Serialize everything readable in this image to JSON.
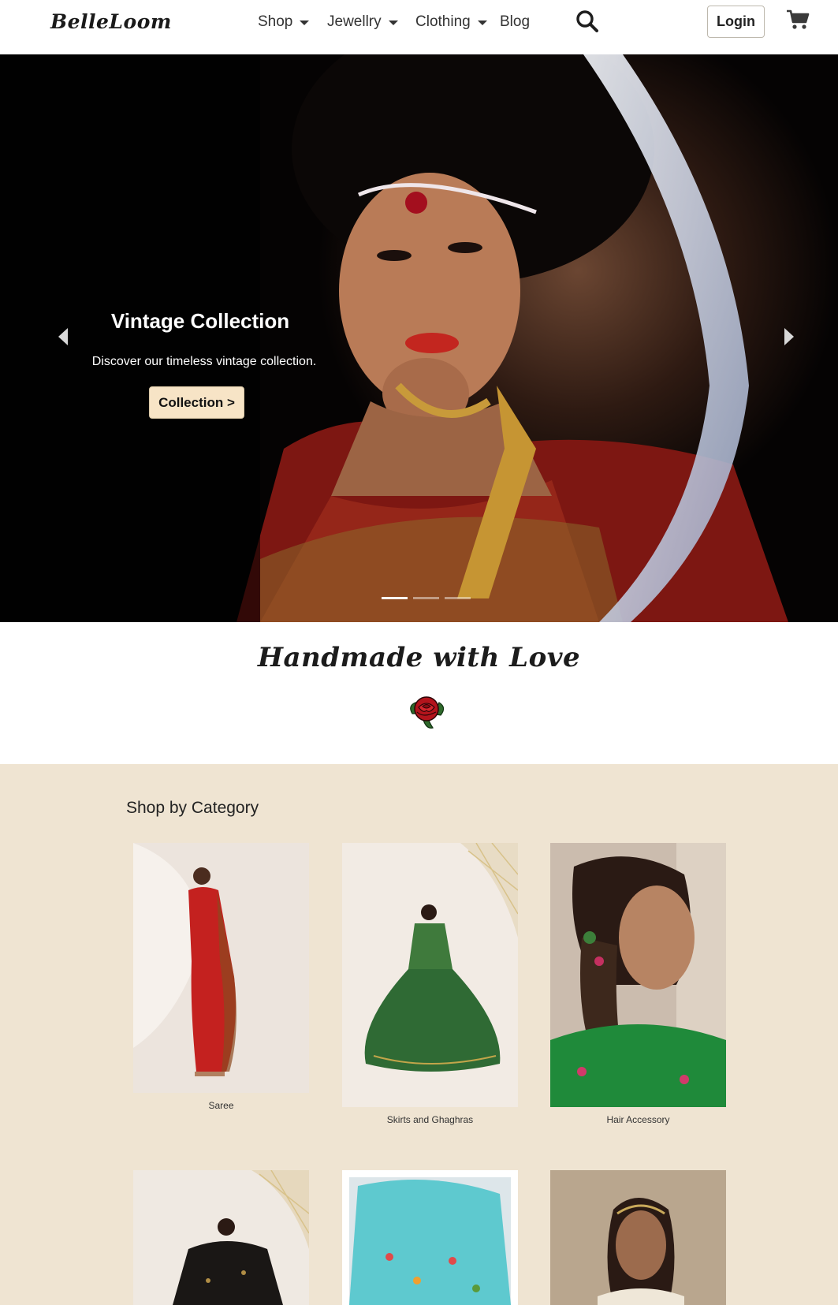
{
  "navbar": {
    "brand": "BelleLoom",
    "menu": [
      {
        "label": "Shop",
        "dropdown": true
      },
      {
        "label": "Jewellry",
        "dropdown": true
      },
      {
        "label": "Clothing",
        "dropdown": true
      },
      {
        "label": "Blog",
        "dropdown": false
      }
    ],
    "search_icon": "search-icon",
    "login_label": "Login",
    "cart_icon": "cart-icon"
  },
  "hero": {
    "title": "Vintage Collection",
    "subtitle": "Discover our timeless vintage collection.",
    "button_label": "Collection >",
    "prev_icon": "chevron-left-icon",
    "next_icon": "chevron-right-icon",
    "slides_count": 3,
    "active_slide": 1,
    "button_color": "#f7e4c6"
  },
  "tagline": {
    "text": "Handmade with Love",
    "icon": "rose-icon"
  },
  "category": {
    "heading": "Shop by Category",
    "background": "#efe4d2",
    "items": [
      {
        "label": "Saree"
      },
      {
        "label": "Skirts and Ghaghras"
      },
      {
        "label": "Hair Accessory"
      },
      {
        "label": ""
      },
      {
        "label": ""
      },
      {
        "label": ""
      }
    ]
  }
}
